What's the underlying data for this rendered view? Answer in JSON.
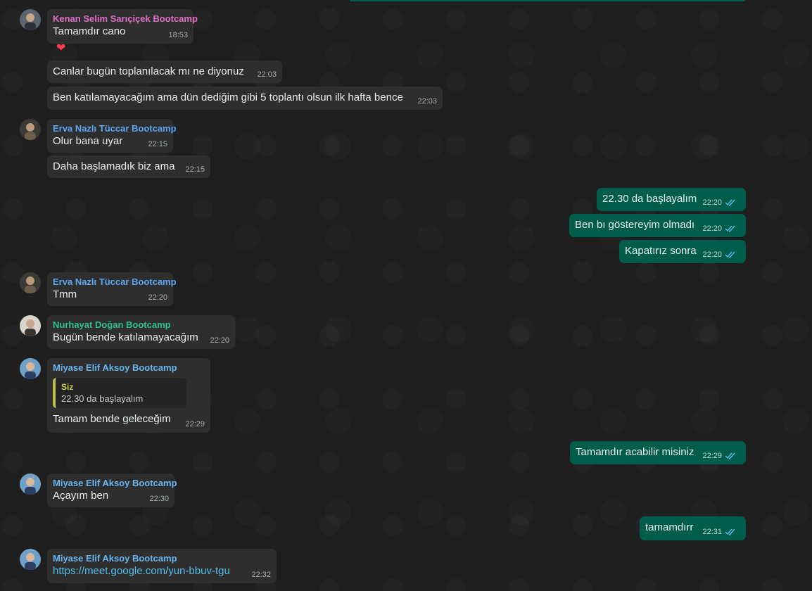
{
  "colors": {
    "background": "#1f1f1f",
    "incoming_bubble": "#2e2e2e",
    "outgoing_bubble": "#005c4b",
    "sender_kenan": "#e06ec7",
    "sender_erva": "#5aa6f2",
    "sender_nurhayat": "#2fbf8f",
    "sender_miyase": "#68b6f0",
    "read_ticks": "#53bdeb"
  },
  "messages": [
    {
      "sender": "Kenan Selim Sarıçiçek Bootcamp",
      "text": "Tamamdır cano",
      "time": "18:53",
      "reaction": "❤"
    },
    {
      "text": "Canlar bugün toplanılacak mı ne diyonuz",
      "time": "22:03"
    },
    {
      "text": "Ben katılamayacağım ama dün dediğim gibi 5 toplantı olsun ilk hafta bence",
      "time": "22:03"
    },
    {
      "sender": "Erva Nazlı Tüccar Bootcamp",
      "text": "Olur bana uyar",
      "time": "22:15"
    },
    {
      "text": "Daha başlamadık biz ama",
      "time": "22:15"
    },
    {
      "text": "22.30 da başlayalım",
      "time": "22:20"
    },
    {
      "text": "Ben bı göstereyim olmadı",
      "time": "22:20"
    },
    {
      "text": "Kapatırız sonra",
      "time": "22:20"
    },
    {
      "sender": "Erva Nazlı Tüccar Bootcamp",
      "text": "Tmm",
      "time": "22:20"
    },
    {
      "sender": "Nurhayat Doğan Bootcamp",
      "text": "Bugün bende katılamayacağım",
      "time": "22:20"
    },
    {
      "sender": "Miyase Elif Aksoy Bootcamp",
      "quote_sender": "Siz",
      "quote_text": "22.30 da başlayalım",
      "text": "Tamam bende geleceğim",
      "time": "22:29"
    },
    {
      "text": "Tamamdır acabilir misiniz",
      "time": "22:29"
    },
    {
      "sender": "Miyase Elif Aksoy Bootcamp",
      "text": "Açayım ben",
      "time": "22:30"
    },
    {
      "text": "tamamdırr",
      "time": "22:31"
    },
    {
      "sender": "Miyase Elif Aksoy Bootcamp",
      "text": "https://meet.google.com/yun-bbuv-tgu",
      "time": "22:32"
    }
  ]
}
